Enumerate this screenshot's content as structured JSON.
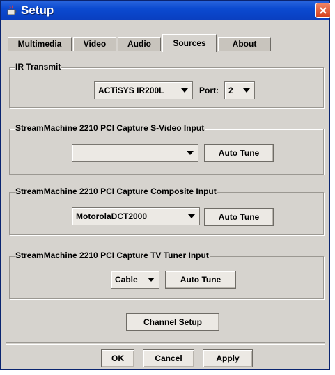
{
  "window": {
    "title": "Setup",
    "icon": "java-cup-icon"
  },
  "tabs": [
    {
      "label": "Multimedia"
    },
    {
      "label": "Video"
    },
    {
      "label": "Audio"
    },
    {
      "label": "Sources",
      "active": true
    },
    {
      "label": "About"
    }
  ],
  "ir_transmit": {
    "label": "IR Transmit",
    "device_value": "ACTiSYS IR200L",
    "port_label": "Port:",
    "port_value": "2"
  },
  "svideo": {
    "label": "StreamMachine 2210 PCI Capture S-Video Input",
    "value": "",
    "auto_tune_label": "Auto Tune"
  },
  "composite": {
    "label": "StreamMachine 2210 PCI Capture Composite Input",
    "value": "MotorolaDCT2000",
    "auto_tune_label": "Auto Tune"
  },
  "tv_tuner": {
    "label": "StreamMachine 2210 PCI Capture TV Tuner Input",
    "value": "Cable",
    "auto_tune_label": "Auto Tune"
  },
  "channel_setup_label": "Channel Setup",
  "footer": {
    "ok_label": "OK",
    "cancel_label": "Cancel",
    "apply_label": "Apply"
  }
}
